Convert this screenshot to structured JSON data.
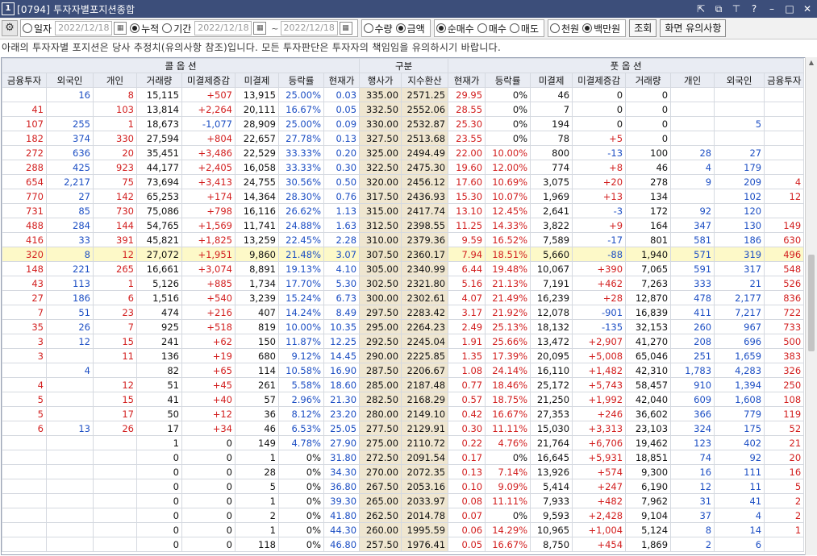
{
  "window": {
    "number": "1",
    "title": "[0794] 투자자별포지션종합"
  },
  "toolbar": {
    "period_options": [
      {
        "label": "일자",
        "selected": false
      },
      {
        "label": "누적",
        "selected": true
      },
      {
        "label": "기간",
        "selected": false
      }
    ],
    "date_from": "2022/12/18",
    "date_to": "2022/12/18",
    "date_sep": "~",
    "qty_options": [
      {
        "label": "수량",
        "selected": false
      },
      {
        "label": "금액",
        "selected": true
      }
    ],
    "trade_options": [
      {
        "label": "순매수",
        "selected": true
      },
      {
        "label": "매수",
        "selected": false
      },
      {
        "label": "매도",
        "selected": false
      }
    ],
    "unit_options": [
      {
        "label": "천원",
        "selected": false
      },
      {
        "label": "백만원",
        "selected": true
      }
    ],
    "query_button": "조회",
    "notice_button": "화면 유의사항"
  },
  "notice": "아래의 투자자별 포지션은 당사 추정치(유의사항 참조)입니다. 모든 투자판단은 투자자의 책임임을 유의하시기 바랍니다.",
  "table": {
    "group_headers": [
      "콜 옵 션",
      "구분",
      "풋 옵 션"
    ],
    "columns": [
      "금융투자",
      "외국인",
      "개인",
      "거래량",
      "미결제증감",
      "미결제",
      "등락률",
      "현재가",
      "행사가",
      "지수환산",
      "현재가",
      "등락률",
      "미결제",
      "미결제증감",
      "거래량",
      "개인",
      "외국인",
      "금융투자"
    ],
    "rows": [
      [
        "",
        "16",
        "8",
        "15,115",
        "+507",
        "13,915",
        "25.00%",
        "0.03",
        "335.00",
        "2571.25",
        "29.95",
        "0%",
        "46",
        "0",
        "0",
        "",
        "",
        ""
      ],
      [
        "41",
        "",
        "103",
        "13,814",
        "+2,264",
        "20,111",
        "16.67%",
        "0.05",
        "332.50",
        "2552.06",
        "28.55",
        "0%",
        "7",
        "0",
        "0",
        "",
        "",
        ""
      ],
      [
        "107",
        "255",
        "1",
        "18,673",
        "-1,077",
        "28,909",
        "25.00%",
        "0.09",
        "330.00",
        "2532.87",
        "25.30",
        "0%",
        "194",
        "0",
        "0",
        "",
        "5",
        ""
      ],
      [
        "182",
        "374",
        "330",
        "27,594",
        "+804",
        "22,657",
        "27.78%",
        "0.13",
        "327.50",
        "2513.68",
        "23.55",
        "0%",
        "78",
        "+5",
        "0",
        "",
        "",
        ""
      ],
      [
        "272",
        "636",
        "20",
        "35,451",
        "+3,486",
        "22,529",
        "33.33%",
        "0.20",
        "325.00",
        "2494.49",
        "22.00",
        "10.00%",
        "800",
        "-13",
        "100",
        "28",
        "27",
        ""
      ],
      [
        "288",
        "425",
        "923",
        "44,177",
        "+2,405",
        "16,058",
        "33.33%",
        "0.30",
        "322.50",
        "2475.30",
        "19.60",
        "12.00%",
        "774",
        "+8",
        "46",
        "4",
        "179",
        ""
      ],
      [
        "654",
        "2,217",
        "75",
        "73,694",
        "+3,413",
        "24,755",
        "30.56%",
        "0.50",
        "320.00",
        "2456.12",
        "17.60",
        "10.69%",
        "3,075",
        "+20",
        "278",
        "9",
        "209",
        "4"
      ],
      [
        "770",
        "27",
        "142",
        "65,253",
        "+174",
        "14,364",
        "28.30%",
        "0.76",
        "317.50",
        "2436.93",
        "15.30",
        "10.07%",
        "1,969",
        "+13",
        "134",
        "",
        "102",
        "12"
      ],
      [
        "731",
        "85",
        "730",
        "75,086",
        "+798",
        "16,116",
        "26.62%",
        "1.13",
        "315.00",
        "2417.74",
        "13.10",
        "12.45%",
        "2,641",
        "-3",
        "172",
        "92",
        "120",
        ""
      ],
      [
        "488",
        "284",
        "144",
        "54,765",
        "+1,569",
        "11,741",
        "24.88%",
        "1.63",
        "312.50",
        "2398.55",
        "11.25",
        "14.33%",
        "3,822",
        "+9",
        "164",
        "347",
        "130",
        "149"
      ],
      [
        "416",
        "33",
        "391",
        "45,821",
        "+1,825",
        "13,259",
        "22.45%",
        "2.28",
        "310.00",
        "2379.36",
        "9.59",
        "16.52%",
        "7,589",
        "-17",
        "801",
        "581",
        "186",
        "630"
      ],
      [
        "320",
        "8",
        "12",
        "27,072",
        "+1,951",
        "9,860",
        "21.48%",
        "3.07",
        "307.50",
        "2360.17",
        "7.94",
        "18.51%",
        "5,660",
        "-88",
        "1,940",
        "571",
        "319",
        "496"
      ],
      [
        "148",
        "221",
        "265",
        "16,661",
        "+3,074",
        "8,891",
        "19.13%",
        "4.10",
        "305.00",
        "2340.99",
        "6.44",
        "19.48%",
        "10,067",
        "+390",
        "7,065",
        "591",
        "317",
        "548"
      ],
      [
        "43",
        "113",
        "1",
        "5,126",
        "+885",
        "1,734",
        "17.70%",
        "5.30",
        "302.50",
        "2321.80",
        "5.16",
        "21.13%",
        "7,191",
        "+462",
        "7,263",
        "333",
        "21",
        "526"
      ],
      [
        "27",
        "186",
        "6",
        "1,516",
        "+540",
        "3,239",
        "15.24%",
        "6.73",
        "300.00",
        "2302.61",
        "4.07",
        "21.49%",
        "16,239",
        "+28",
        "12,870",
        "478",
        "2,177",
        "836"
      ],
      [
        "7",
        "51",
        "23",
        "474",
        "+216",
        "407",
        "14.24%",
        "8.49",
        "297.50",
        "2283.42",
        "3.17",
        "21.92%",
        "12,078",
        "-901",
        "16,839",
        "411",
        "7,217",
        "722"
      ],
      [
        "35",
        "26",
        "7",
        "925",
        "+518",
        "819",
        "10.00%",
        "10.35",
        "295.00",
        "2264.23",
        "2.49",
        "25.13%",
        "18,132",
        "-135",
        "32,153",
        "260",
        "967",
        "733"
      ],
      [
        "3",
        "12",
        "15",
        "241",
        "+62",
        "150",
        "11.87%",
        "12.25",
        "292.50",
        "2245.04",
        "1.91",
        "25.66%",
        "13,472",
        "+2,907",
        "41,270",
        "208",
        "696",
        "500"
      ],
      [
        "3",
        "",
        "11",
        "136",
        "+19",
        "680",
        "9.12%",
        "14.45",
        "290.00",
        "2225.85",
        "1.35",
        "17.39%",
        "20,095",
        "+5,008",
        "65,046",
        "251",
        "1,659",
        "383"
      ],
      [
        "",
        "4",
        "",
        "82",
        "+65",
        "114",
        "10.58%",
        "16.90",
        "287.50",
        "2206.67",
        "1.08",
        "24.14%",
        "16,110",
        "+1,482",
        "42,310",
        "1,783",
        "4,283",
        "326"
      ],
      [
        "4",
        "",
        "12",
        "51",
        "+45",
        "261",
        "5.58%",
        "18.60",
        "285.00",
        "2187.48",
        "0.77",
        "18.46%",
        "25,172",
        "+5,743",
        "58,457",
        "910",
        "1,394",
        "250"
      ],
      [
        "5",
        "",
        "15",
        "41",
        "+40",
        "57",
        "2.96%",
        "21.30",
        "282.50",
        "2168.29",
        "0.57",
        "18.75%",
        "21,250",
        "+1,992",
        "42,040",
        "609",
        "1,608",
        "108"
      ],
      [
        "5",
        "",
        "17",
        "50",
        "+12",
        "36",
        "8.12%",
        "23.20",
        "280.00",
        "2149.10",
        "0.42",
        "16.67%",
        "27,353",
        "+246",
        "36,602",
        "366",
        "779",
        "119"
      ],
      [
        "6",
        "13",
        "26",
        "17",
        "+34",
        "46",
        "6.53%",
        "25.05",
        "277.50",
        "2129.91",
        "0.30",
        "11.11%",
        "15,030",
        "+3,313",
        "23,103",
        "324",
        "175",
        "52"
      ],
      [
        "",
        "",
        "",
        "1",
        "0",
        "149",
        "4.78%",
        "27.90",
        "275.00",
        "2110.72",
        "0.22",
        "4.76%",
        "21,764",
        "+6,706",
        "19,462",
        "123",
        "402",
        "21"
      ],
      [
        "",
        "",
        "",
        "0",
        "0",
        "1",
        "0%",
        "31.80",
        "272.50",
        "2091.54",
        "0.17",
        "0%",
        "16,645",
        "+5,931",
        "18,851",
        "74",
        "92",
        "20"
      ],
      [
        "",
        "",
        "",
        "0",
        "0",
        "28",
        "0%",
        "34.30",
        "270.00",
        "2072.35",
        "0.13",
        "7.14%",
        "13,926",
        "+574",
        "9,300",
        "16",
        "111",
        "16"
      ],
      [
        "",
        "",
        "",
        "0",
        "0",
        "5",
        "0%",
        "36.80",
        "267.50",
        "2053.16",
        "0.10",
        "9.09%",
        "5,414",
        "+247",
        "6,190",
        "12",
        "11",
        "5"
      ],
      [
        "",
        "",
        "",
        "0",
        "0",
        "1",
        "0%",
        "39.30",
        "265.00",
        "2033.97",
        "0.08",
        "11.11%",
        "7,933",
        "+482",
        "7,962",
        "31",
        "41",
        "2"
      ],
      [
        "",
        "",
        "",
        "0",
        "0",
        "2",
        "0%",
        "41.80",
        "262.50",
        "2014.78",
        "0.07",
        "0%",
        "9,593",
        "+2,428",
        "9,104",
        "37",
        "4",
        "2"
      ],
      [
        "",
        "",
        "",
        "0",
        "0",
        "1",
        "0%",
        "44.30",
        "260.00",
        "1995.59",
        "0.06",
        "14.29%",
        "10,965",
        "+1,004",
        "5,124",
        "8",
        "14",
        "1"
      ],
      [
        "",
        "",
        "",
        "0",
        "0",
        "118",
        "0%",
        "46.80",
        "257.50",
        "1976.41",
        "0.05",
        "16.67%",
        "8,750",
        "+454",
        "1,869",
        "2",
        "6",
        ""
      ]
    ],
    "highlight_row": 11,
    "colors": {
      "up": "#d21f1f",
      "down": "#1d4fc4",
      "highlight": "#fdf9c8",
      "strike_column": "#efe6d0",
      "header": "#e9ecf3"
    }
  }
}
